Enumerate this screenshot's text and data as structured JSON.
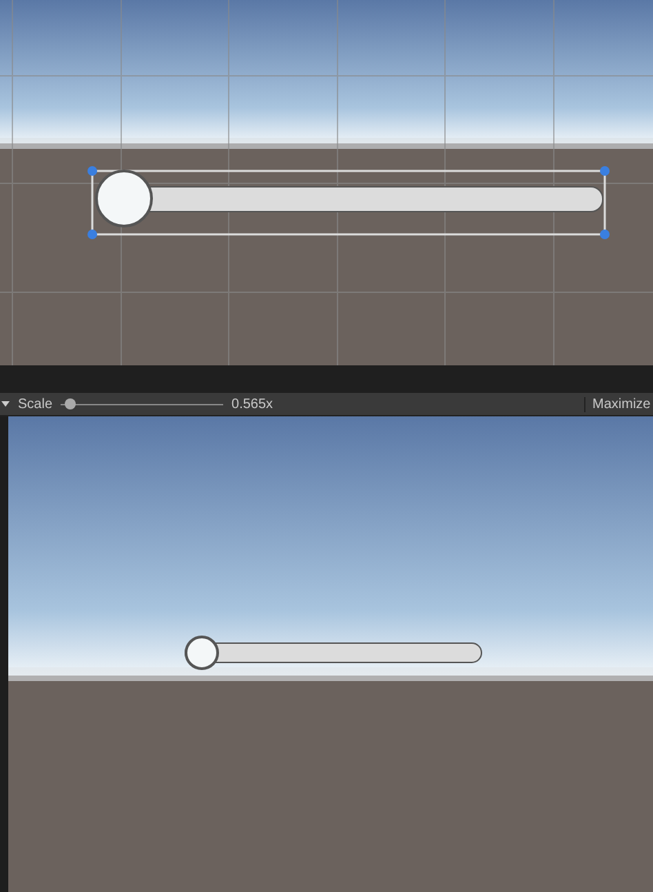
{
  "scene_view": {
    "slider": {
      "level": 0,
      "selected": true
    }
  },
  "game_toolbar": {
    "scale_label": "Scale",
    "scale_slider": {
      "level": 0.03
    },
    "scale_reading": "0.565x",
    "maximize_label": "Maximize"
  },
  "game_view": {
    "slider": {
      "level": 0
    }
  }
}
